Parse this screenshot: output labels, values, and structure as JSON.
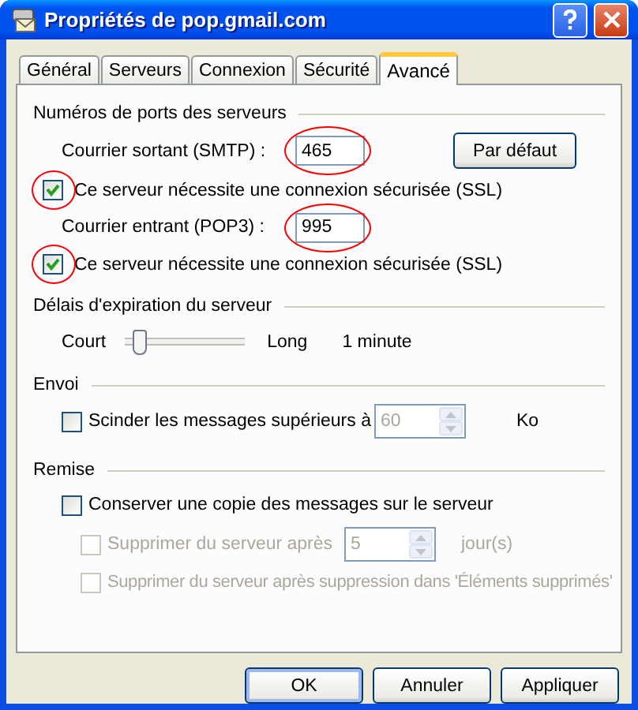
{
  "window": {
    "title": "Propriétés de pop.gmail.com"
  },
  "tabs": [
    {
      "label": "Général",
      "selected": false
    },
    {
      "label": "Serveurs",
      "selected": false
    },
    {
      "label": "Connexion",
      "selected": false
    },
    {
      "label": "Sécurité",
      "selected": false
    },
    {
      "label": "Avancé",
      "selected": true
    }
  ],
  "ports": {
    "heading": "Numéros de ports des serveurs",
    "default_button": "Par défaut",
    "rows": [
      {
        "label": "Courrier sortant (SMTP) :",
        "value": "465",
        "circled": true,
        "ssl": {
          "label": "Ce serveur nécessite une connexion sécurisée (SSL)",
          "checked": true,
          "circled": true
        }
      },
      {
        "label": "Courrier entrant (POP3) :",
        "value": "995",
        "circled": true,
        "ssl": {
          "label": "Ce serveur nécessite une connexion sécurisée (SSL)",
          "checked": true,
          "circled": true
        }
      }
    ]
  },
  "timeout": {
    "heading": "Délais d'expiration du serveur",
    "min_label": "Court",
    "max_label": "Long",
    "level": 0.12,
    "reading": "1 minute"
  },
  "sending": {
    "heading": "Envoi",
    "label": "Scinder les messages supérieurs à",
    "checked": false,
    "value": "60",
    "value_disabled": true,
    "unit": "Ko"
  },
  "delivery": {
    "heading": "Remise",
    "keep": {
      "label": "Conserver une copie des messages sur le serveur",
      "checked": false
    },
    "delete_after": {
      "label": "Supprimer du serveur après",
      "checked": false,
      "disabled": true,
      "value": "5",
      "unit": "jour(s)"
    },
    "delete_on_remove": {
      "label": "Supprimer du serveur après suppression dans 'Éléments supprimés'",
      "checked": false,
      "disabled": true
    }
  },
  "buttons": [
    {
      "label": "OK",
      "default": true
    },
    {
      "label": "Annuler",
      "default": false
    },
    {
      "label": "Appliquer",
      "default": false
    }
  ]
}
